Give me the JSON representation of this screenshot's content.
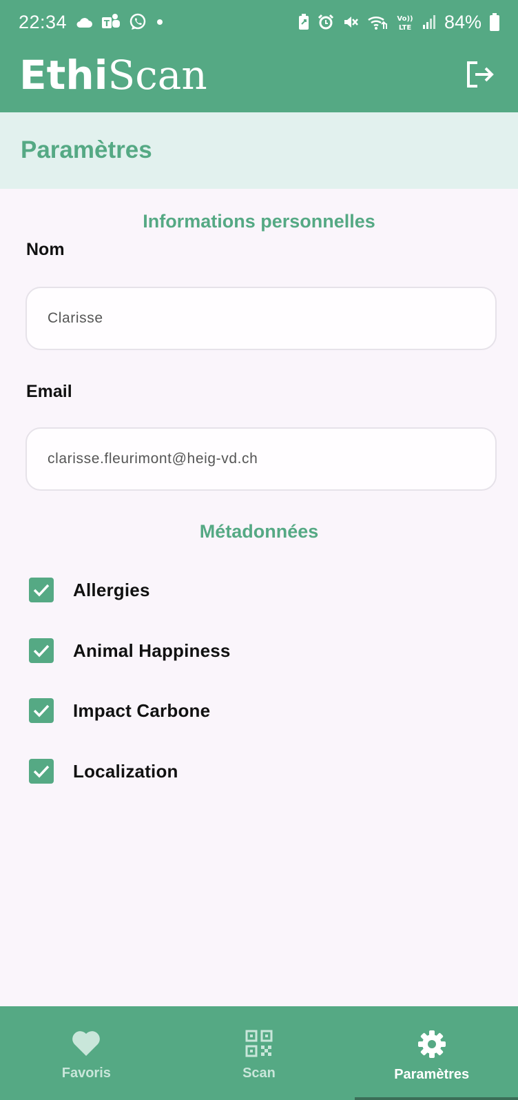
{
  "status_bar": {
    "time": "22:34",
    "battery": "84%",
    "left_icons": [
      "cloud-icon",
      "teams-icon",
      "whatsapp-icon",
      "dot-icon"
    ],
    "right_icons": [
      "battery-saver-icon",
      "alarm-icon",
      "mute-icon",
      "wifi-icon",
      "volte-icon",
      "signal-icon",
      "battery-icon"
    ]
  },
  "header": {
    "title_part1": "Ethi",
    "title_part2": "Scan",
    "logout_icon": "logout-icon"
  },
  "page": {
    "title": "Paramètres"
  },
  "personal": {
    "heading": "Informations personnelles",
    "name_label": "Nom",
    "name_value": "Clarisse",
    "email_label": "Email",
    "email_value": "clarisse.fleurimont@heig-vd.ch"
  },
  "metadata": {
    "heading": "Métadonnées",
    "items": [
      {
        "label": "Allergies",
        "checked": true
      },
      {
        "label": "Animal Happiness",
        "checked": true
      },
      {
        "label": "Impact Carbone",
        "checked": true
      },
      {
        "label": "Localization",
        "checked": true
      }
    ]
  },
  "nav": {
    "items": [
      {
        "label": "Favoris",
        "icon": "heart-icon",
        "active": false
      },
      {
        "label": "Scan",
        "icon": "qr-code-icon",
        "active": false
      },
      {
        "label": "Paramètres",
        "icon": "gear-icon",
        "active": true
      }
    ]
  },
  "colors": {
    "primary": "#55a984",
    "header_band": "#e2f1ee",
    "background": "#faf5fb"
  }
}
